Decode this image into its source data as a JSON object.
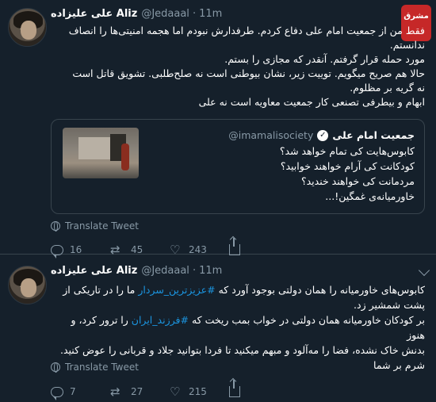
{
  "colors": {
    "background": "#15202b",
    "link": "#1b95e0",
    "muted": "#8899a6",
    "border": "#38444d"
  },
  "tweets": [
    {
      "author": {
        "display_name": "علی علیزاده Aliz",
        "handle": "@Jedaaal",
        "time": "11m"
      },
      "watermark": "مشرق",
      "lines": [
        "فقط من از جمعیت امام علی دفاع کردم. طرفدارش نبودم اما هجمه امنیتی‌ها را انصاف",
        "ندانستم.",
        "مورد حمله قرار گرفتم. آنقدر که مجازی را بستم.",
        "حالا هم صریح میگویم. توییت زیر، نشان بیوطنی است نه صلح‌طلبی. تشویق قاتل است",
        "نه گریه بر مظلوم.",
        "ابهام و بیطرفی تصنعی کار جمعیت معاویه است نه علی"
      ],
      "quoted": {
        "name": "جمعیت امام علی",
        "handle": "@imamalisociety",
        "verified_icon": "check-badge-icon",
        "lines": [
          "کابوس‌هایت کی تمام خواهد شد؟",
          "کودکانت کی آرام خواهند خوابید؟",
          "مردمانت کی خواهند خندید؟",
          "خاورمیانه‌ی غمگین!..."
        ]
      },
      "translate_label": "Translate Tweet",
      "actions": {
        "replies": "16",
        "retweets": "45",
        "likes": "243"
      }
    },
    {
      "author": {
        "display_name": "علی علیزاده Aliz",
        "handle": "@Jedaaal",
        "time": "11m"
      },
      "lines_rich": [
        [
          "کابوس‌های خاورمیانه را همان دولتی بوجود آورد که ",
          "#عزیزترین_سردار",
          " ما را در تاریکی از"
        ],
        [
          "پشت شمشیر زد.",
          "",
          ""
        ],
        [
          "بر کودکان خاورمیانه همان دولتی در خواب بمب ریخت که ",
          "#فرزند_ایران",
          " را ترور کرد، و هنوز"
        ],
        [
          "بدنش خاک نشده، فضا را مه‌آلود و مبهم میکنید تا فردا بتوانید جلاد و قربانی را عوض کنید.",
          "",
          ""
        ],
        [
          "شرم بر شما",
          "",
          ""
        ]
      ],
      "translate_label": "Translate Tweet",
      "actions": {
        "replies": "7",
        "retweets": "27",
        "likes": "215"
      }
    }
  ]
}
